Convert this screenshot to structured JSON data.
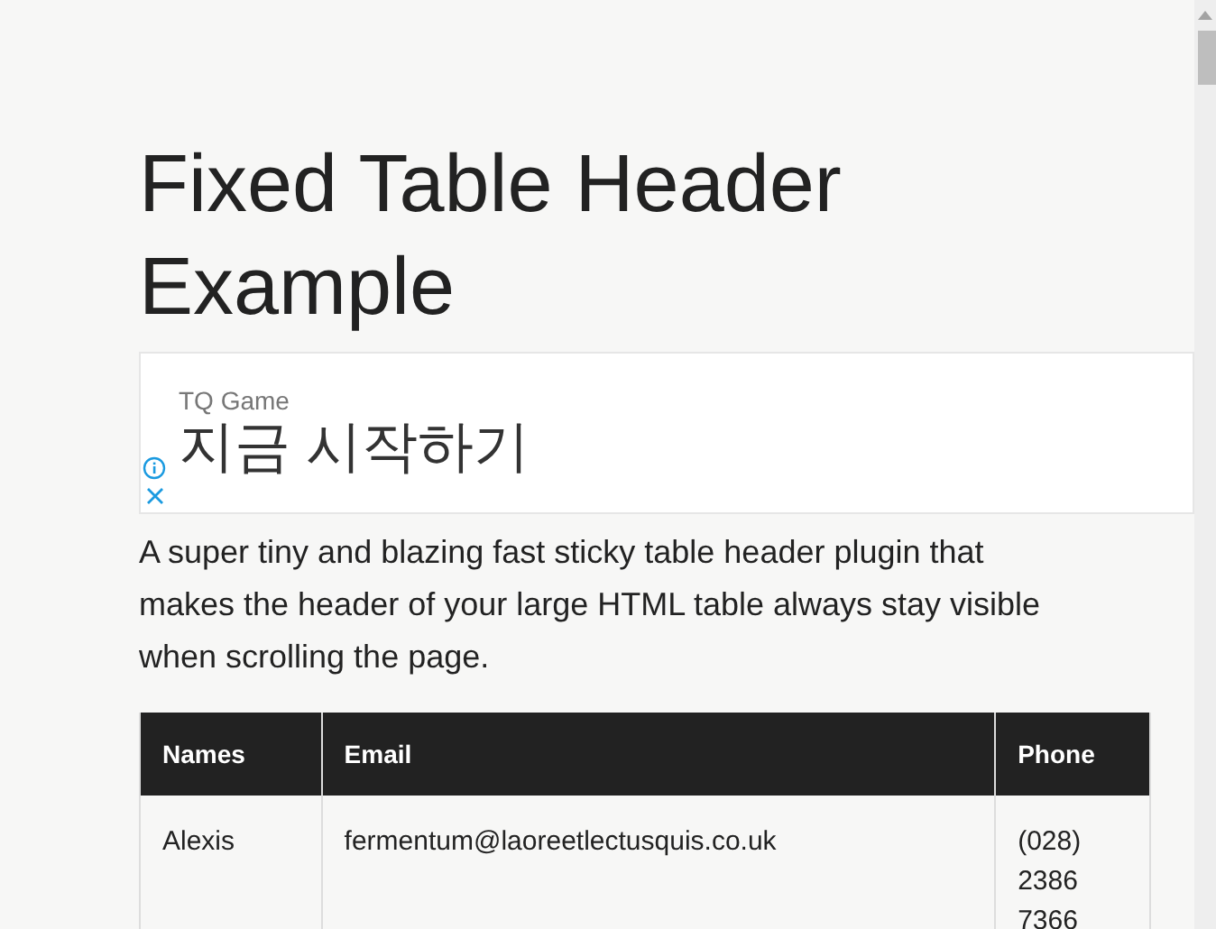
{
  "title": "Fixed Table Header Example",
  "ad": {
    "advertiser": "TQ Game",
    "headline": "지금 시작하기"
  },
  "intro": "A super tiny and blazing fast sticky table header plugin that makes the header of your large HTML table always stay visible when scrolling the page.",
  "table": {
    "columns": [
      "Names",
      "Email",
      "Phone"
    ],
    "rows": [
      [
        "Alexis",
        "fermentum@laoreetlectusquis.co.uk",
        "(028) 2386 7366"
      ]
    ]
  }
}
